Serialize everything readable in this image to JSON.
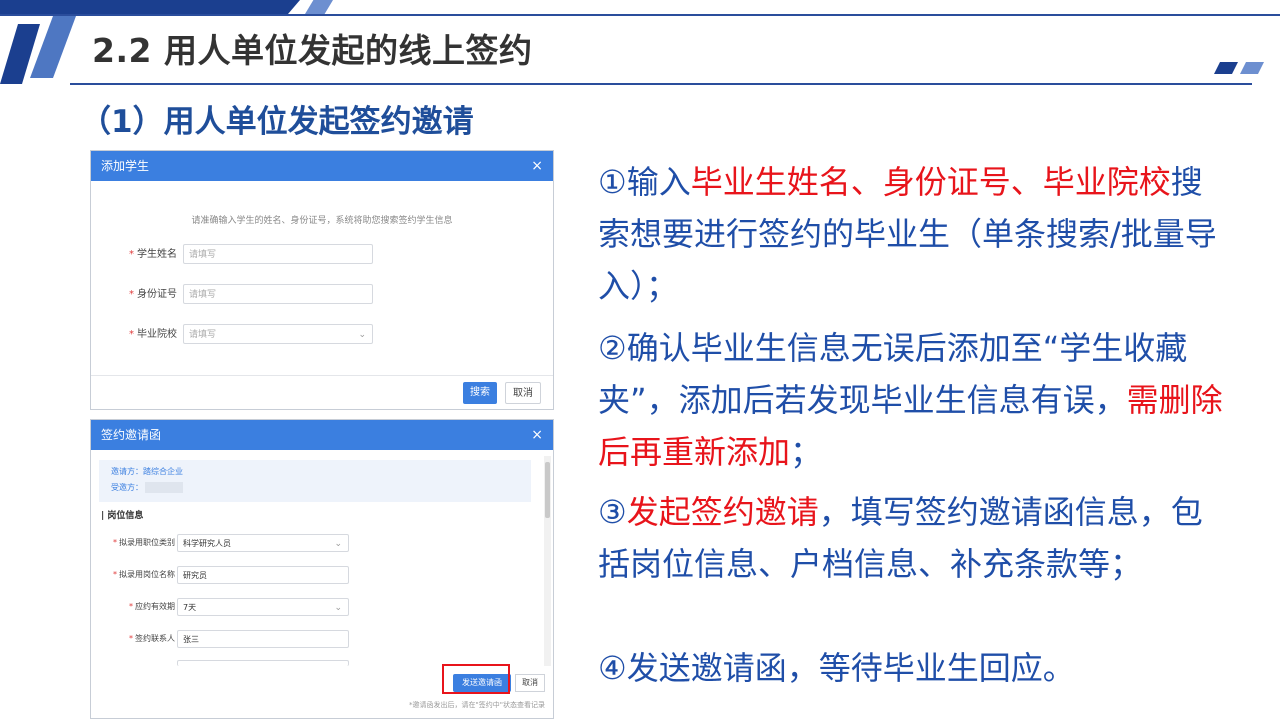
{
  "slide": {
    "title": "2.2 用人单位发起的线上签约",
    "subtitle": "（1）用人单位发起签约邀请"
  },
  "colors": {
    "accent": "#1f4ea8",
    "highlight": "#e8141b",
    "dialog_header": "#3b7fe0"
  },
  "add_student_dialog": {
    "title": "添加学生",
    "close_icon": "×",
    "hint": "请准确输入学生的姓名、身份证号，系统将助您搜索签约学生信息",
    "fields": [
      {
        "label": "学生姓名",
        "placeholder": "请填写"
      },
      {
        "label": "身份证号",
        "placeholder": "请填写"
      },
      {
        "label": "毕业院校",
        "placeholder": "请填写"
      }
    ],
    "search_button": "搜索",
    "cancel_button": "取消"
  },
  "invite_dialog": {
    "title": "签约邀请函",
    "close_icon": "×",
    "inviter_label": "邀请方：",
    "inviter_value": "踏综合企业",
    "invitee_label": "受邀方：",
    "section_title": "| 岗位信息",
    "fields": [
      {
        "label": "拟录用职位类别",
        "value": "科学研究人员"
      },
      {
        "label": "拟录用岗位名称",
        "value": "研究员"
      },
      {
        "label": "应约有效期",
        "value": "7天"
      },
      {
        "label": "签约联系人",
        "value": "张三"
      }
    ],
    "send_button": "发送邀请函",
    "cancel_button": "取消",
    "note": "*邀请函发出后，请在\"签约中\"状态查看记录"
  },
  "steps": {
    "s1": {
      "a": "①输入",
      "b": "毕业生姓名、身份证号、毕业院校",
      "c": "搜索想要进行签约的毕业生（单条搜索/批量导入）；"
    },
    "s2": {
      "a": "②确认毕业生信息无误后添加至“学生收藏夹”，添加后若发现毕业生信息有误，",
      "b": "需删除后再重新添加",
      "c": "；"
    },
    "s3": {
      "a": "③",
      "b": "发起签约邀请",
      "c": "，填写签约邀请函信息，包括岗位信息、户档信息、补充条款等；"
    },
    "s4": {
      "a": "④发送邀请函，等待毕业生回应。"
    }
  }
}
